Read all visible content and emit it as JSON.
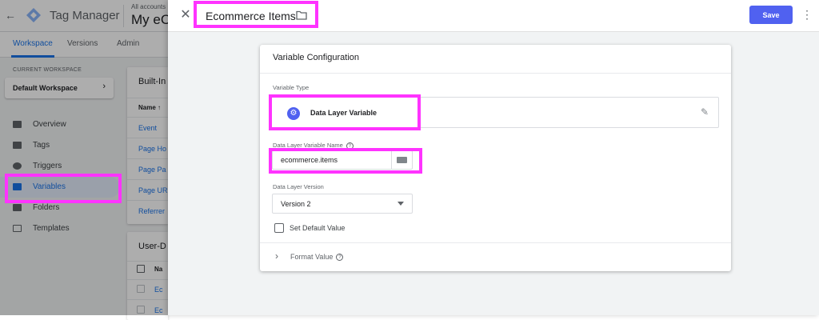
{
  "background": {
    "app_name": "Tag Manager",
    "breadcrumb": "All accounts",
    "container_name": "My eC",
    "tabs": [
      {
        "label": "Workspace",
        "active": true
      },
      {
        "label": "Versions",
        "active": false
      },
      {
        "label": "Admin",
        "active": false
      }
    ],
    "current_workspace_label": "CURRENT WORKSPACE",
    "workspace_name": "Default Workspace",
    "nav": [
      {
        "label": "Overview",
        "icon": "overview-icon"
      },
      {
        "label": "Tags",
        "icon": "tag-icon"
      },
      {
        "label": "Triggers",
        "icon": "trigger-icon"
      },
      {
        "label": "Variables",
        "icon": "variables-icon",
        "active": true
      },
      {
        "label": "Folders",
        "icon": "folder-icon"
      },
      {
        "label": "Templates",
        "icon": "template-icon"
      }
    ],
    "builtin_panel": {
      "title": "Built-In",
      "col_name": "Name ↑",
      "rows": [
        "Event",
        "Page Ho",
        "Page Pa",
        "Page UR",
        "Referrer"
      ]
    },
    "user_panel": {
      "title": "User-D",
      "col_name": "Na",
      "rows": [
        "Ec",
        "Ec"
      ]
    }
  },
  "editor": {
    "title": "Ecommerce Items",
    "save_label": "Save",
    "card_title": "Variable Configuration",
    "variable_type_label": "Variable Type",
    "variable_type_value": "Data Layer Variable",
    "dlv_name_label": "Data Layer Variable Name",
    "dlv_name_value": "ecommerce.items",
    "dlv_version_label": "Data Layer Version",
    "dlv_version_value": "Version 2",
    "set_default_label": "Set Default Value",
    "format_value_label": "Format Value"
  },
  "colors": {
    "highlight": "#ff33ff",
    "save_button": "#5061f0",
    "accent_blue": "#1a73e8"
  }
}
